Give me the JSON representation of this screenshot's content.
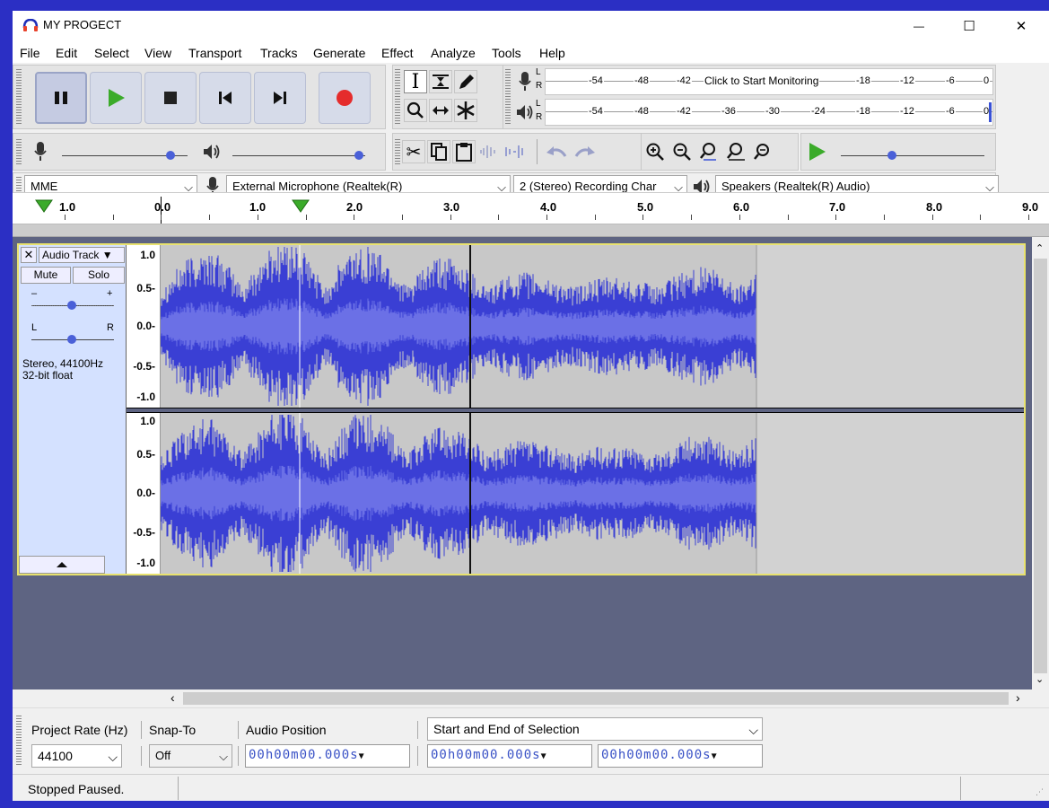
{
  "window": {
    "title": "MY PROGECT",
    "minimize": "—",
    "maximize": "☐",
    "close": "✕"
  },
  "menu": [
    "File",
    "Edit",
    "Select",
    "View",
    "Transport",
    "Tracks",
    "Generate",
    "Effect",
    "Analyze",
    "Tools",
    "Help"
  ],
  "meters": {
    "record_ticks": [
      "-54",
      "-48",
      "-42",
      "Click to Start Monitoring",
      "-18",
      "-12",
      "-6",
      "0"
    ],
    "playback_ticks": [
      "-54",
      "-48",
      "-42",
      "-36",
      "-30",
      "-24",
      "-18",
      "-12",
      "-6",
      "0"
    ],
    "lr": [
      "L",
      "R"
    ]
  },
  "device": {
    "host": "MME",
    "input": "External Microphone (Realtek(R)",
    "channels": "2 (Stereo) Recording Char",
    "output": "Speakers (Realtek(R) Audio)"
  },
  "ruler": [
    "1.0",
    "0.0",
    "1.0",
    "2.0",
    "3.0",
    "4.0",
    "5.0",
    "6.0",
    "7.0",
    "8.0",
    "9.0"
  ],
  "track": {
    "close": "✕",
    "name": "Audio Track ▼",
    "mute": "Mute",
    "solo": "Solo",
    "gain_minus": "–",
    "gain_plus": "+",
    "pan_left": "L",
    "pan_right": "R",
    "info_line1": "Stereo, 44100Hz",
    "info_line2": "32-bit float",
    "scale": [
      "1.0",
      "0.5-",
      "0.0-",
      "-0.5-",
      "-1.0"
    ]
  },
  "selection_toolbar": {
    "project_rate_label": "Project Rate (Hz)",
    "project_rate_value": "44100",
    "snap_label": "Snap-To",
    "snap_value": "Off",
    "audio_position_label": "Audio Position",
    "audio_position_value": "00h00m00.000s",
    "selection_mode": "Start and End of Selection",
    "selection_start": "00h00m00.000s",
    "selection_end": "00h00m00.000s"
  },
  "status": "Stopped Paused.",
  "colors": {
    "waveform": "#3a3fd4",
    "waveform_rms": "#6b70e6",
    "clip_bg": "#c8c8c8",
    "track_border": "#e8e26e",
    "record": "#e52c2c",
    "play": "#3bab2a",
    "background": "#5e6482"
  }
}
